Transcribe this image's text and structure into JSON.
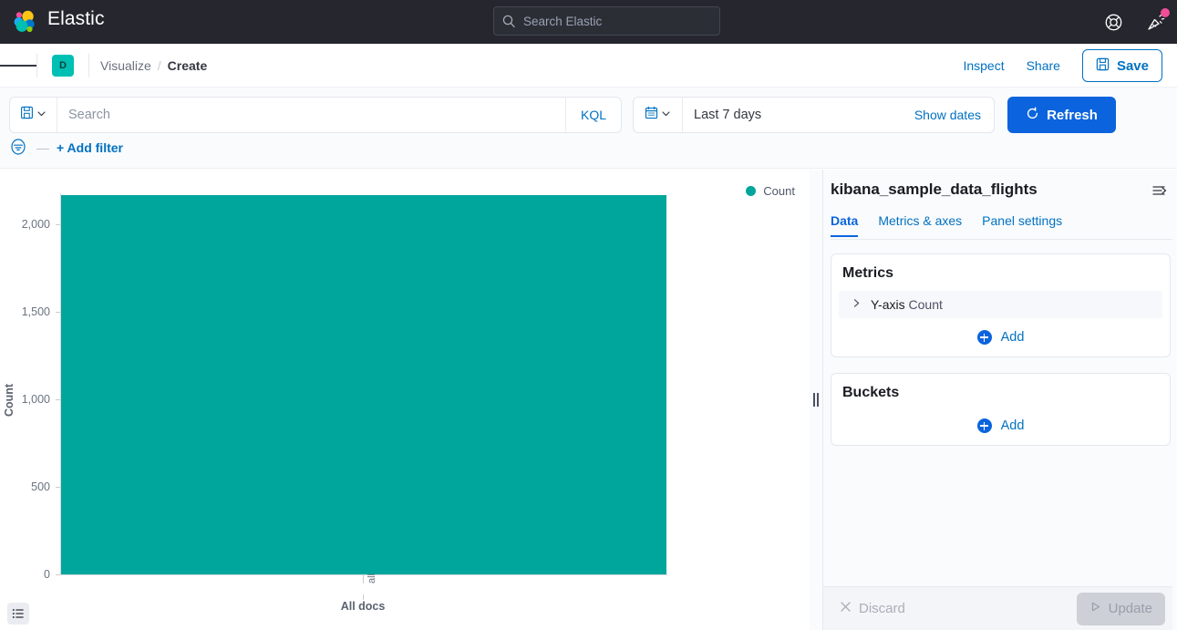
{
  "topbar": {
    "brand": "Elastic",
    "search_placeholder": "Search Elastic",
    "search_icon": "search-icon",
    "help_icon": "help-lifebuoy-icon",
    "whatsnew_icon": "party-popper-icon",
    "notification_dot_color": "#f04e98"
  },
  "breadcrumbbar": {
    "menu_icon": "hamburger-menu-icon",
    "project_badge": "D",
    "crumbs": [
      {
        "label": "Visualize",
        "active": false
      },
      {
        "label": "Create",
        "active": true
      }
    ],
    "separator": "/",
    "inspect_label": "Inspect",
    "share_label": "Share",
    "save_label": "Save",
    "save_icon": "save-disk-icon"
  },
  "querybar": {
    "saved_query_icon": "saved-query-disk-icon",
    "saved_query_chevron": "chevron-down-icon",
    "search_placeholder": "Search",
    "search_value": "",
    "language_label": "KQL",
    "calendar_icon": "calendar-icon",
    "calendar_chevron": "chevron-down-icon",
    "time_range": "Last 7 days",
    "show_dates_label": "Show dates",
    "refresh_label": "Refresh",
    "refresh_icon": "refresh-icon",
    "filter_icon": "filter-funnel-icon",
    "filter_dash": "—",
    "add_filter_label": "+ Add filter"
  },
  "chart_data": {
    "type": "bar",
    "title": "",
    "categories": [
      "all"
    ],
    "values": [
      2167
    ],
    "series": [
      {
        "name": "Count",
        "values": [
          2167
        ]
      }
    ],
    "xlabel": "All docs",
    "ylabel": "Count",
    "ylim": [
      0,
      2167
    ],
    "yticks": [
      0,
      500,
      1000,
      1500,
      2000
    ],
    "ytick_labels": [
      "0",
      "500",
      "1,000",
      "1,500",
      "2,000"
    ],
    "xtick_labels": [
      "all"
    ],
    "grid": false,
    "legend": {
      "position": "top-right",
      "entries": [
        "Count"
      ]
    },
    "bar_color": "#00a69b"
  },
  "chart": {
    "legend_label": "Count",
    "yaxis_title": "Count",
    "xaxis_title": "All docs",
    "xtick_label": "all",
    "inspect_icon": "list-inspect-icon"
  },
  "resize": {
    "handle_icon": "drag-handle-icon"
  },
  "sidepane": {
    "index_title": "kibana_sample_data_flights",
    "collapse_icon": "collapse-panel-icon",
    "tabs": [
      {
        "label": "Data",
        "active": true
      },
      {
        "label": "Metrics & axes",
        "active": false
      },
      {
        "label": "Panel settings",
        "active": false
      }
    ],
    "metrics": {
      "title": "Metrics",
      "rows": [
        {
          "expander_icon": "chevron-right-icon",
          "axis": "Y-axis",
          "agg": "Count"
        }
      ],
      "add_label": "Add",
      "add_icon": "plus-circle-icon"
    },
    "buckets": {
      "title": "Buckets",
      "add_label": "Add",
      "add_icon": "plus-circle-icon"
    },
    "footer": {
      "discard_label": "Discard",
      "discard_icon": "close-x-icon",
      "update_label": "Update",
      "update_icon": "play-triangle-icon",
      "discard_enabled": false,
      "update_enabled": false
    }
  },
  "colors": {
    "topbar_bg": "#25262e",
    "accent_teal": "#00a69b",
    "badge_teal": "#00bfb3",
    "link_blue": "#0071c2",
    "primary_blue": "#0b64dd",
    "pink": "#f04e98"
  }
}
